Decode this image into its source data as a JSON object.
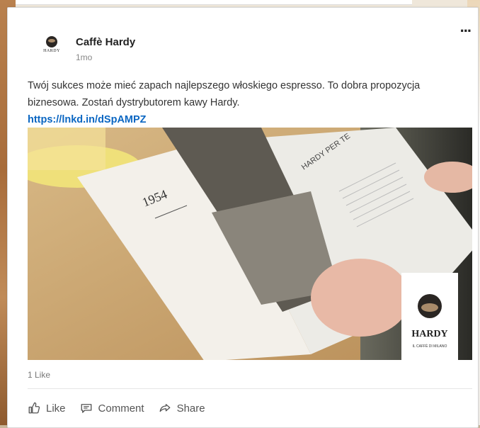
{
  "post": {
    "author": "Caffè Hardy",
    "time": "1mo",
    "menu": "...",
    "text": "Twój sukces może mieć zapach najlepszego włoskiego espresso. To dobra propozycja biznesowa. Zostań dystrybutorem kawy Hardy.",
    "link": "https://lnkd.in/dSpAMPZ",
    "logo_word": "HARDY",
    "image": {
      "book_year": "1954",
      "book_heading": "HARDY PER TE",
      "brand_name": "HARDY",
      "brand_tagline": "IL CAFFÈ DI MILANO"
    },
    "reactions": "1 Like"
  },
  "actions": {
    "like": "Like",
    "comment": "Comment",
    "share": "Share"
  },
  "icons": {
    "like": "thumbs-up-icon",
    "comment": "comment-icon",
    "share": "share-arrow-icon"
  }
}
